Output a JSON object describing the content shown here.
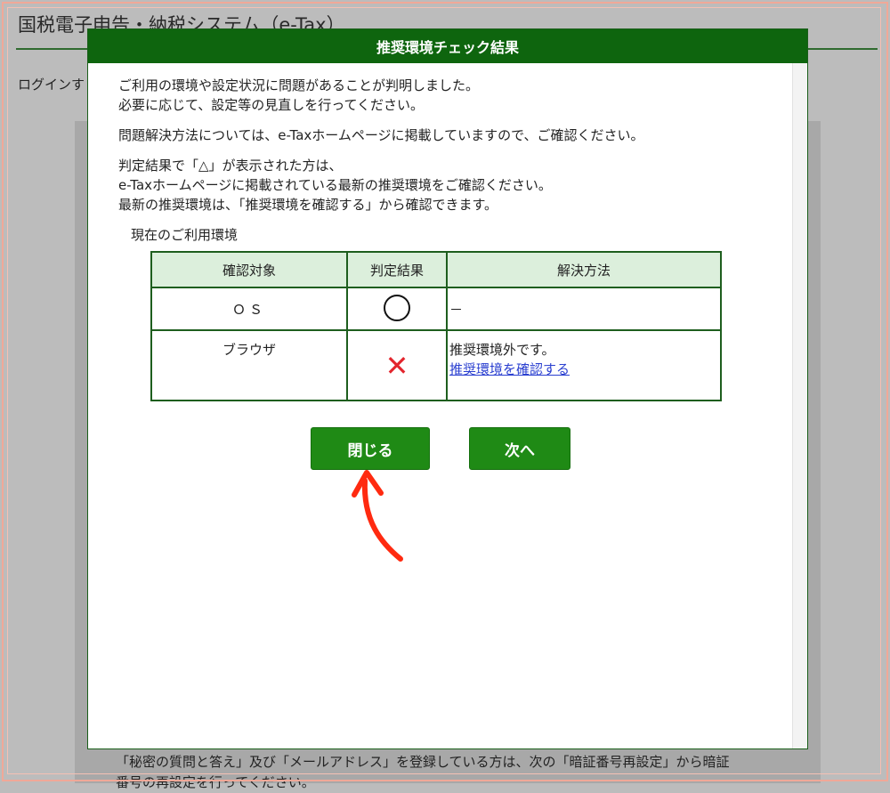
{
  "background": {
    "title": "国税電子申告・納税システム（e-Tax）",
    "login_text": "ログインす",
    "bottom_text_line1": "「秘密の質問と答え」及び「メールアドレス」を登録している方は、次の「暗証番号再設定」から暗証",
    "bottom_text_line2": "番号の再設定を行ってください。"
  },
  "modal": {
    "title": "推奨環境チェック結果",
    "paragraphs": [
      [
        "ご利用の環境や設定状況に問題があることが判明しました。",
        "必要に応じて、設定等の見直しを行ってください。"
      ],
      [
        "問題解決方法については、e-Taxホームページに掲載していますので、ご確認ください。"
      ],
      [
        "判定結果で「△」が表示された方は、",
        "e-Taxホームページに掲載されている最新の推奨環境をご確認ください。",
        "最新の推奨環境は、「推奨環境を確認する」から確認できます。"
      ]
    ],
    "env_label": "現在のご利用環境",
    "table": {
      "headers": [
        "確認対象",
        "判定結果",
        "解決方法"
      ],
      "rows": [
        {
          "target": "ＯＳ",
          "result_icon": "circle-ok-icon",
          "solution": "－"
        },
        {
          "target": "ブラウザ",
          "result_icon": "cross-ng-icon",
          "result_symbol": "✕",
          "solution": "推奨環境外です。",
          "link": "推奨環境を確認する"
        }
      ]
    },
    "buttons": {
      "close": "閉じる",
      "next": "次へ"
    }
  },
  "colors": {
    "header_green": "#0e650e",
    "button_green": "#1f8a15",
    "cross_red": "#e3262e",
    "arrow_red": "#ff2a10"
  }
}
